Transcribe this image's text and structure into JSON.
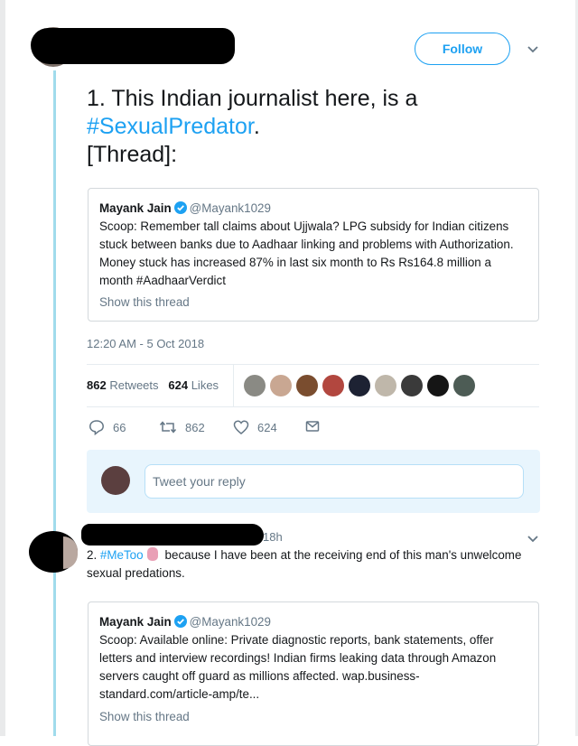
{
  "main_tweet": {
    "follow_label": "Follow",
    "text_line1": "1. This Indian journalist here, is a",
    "hashtag": "#SexualPredator",
    "hashtag_suffix": ".",
    "text_line3": "[Thread]:",
    "quoted": {
      "name": "Mayank Jain",
      "handle": "@Mayank1029",
      "text": "Scoop: Remember tall claims about Ujjwala? LPG subsidy for Indian citizens stuck between banks due to Aadhaar linking and problems with Authorization. Money stuck has increased 87% in last six month to Rs Rs164.8 million a month #AadhaarVerdict",
      "show_thread": "Show this thread"
    },
    "timestamp": "12:20 AM - 5 Oct 2018",
    "retweets_count": "862",
    "retweets_label": "Retweets",
    "likes_count": "624",
    "likes_label": "Likes",
    "liker_colors": [
      "#8a8a84",
      "#c9a792",
      "#7a4d2f",
      "#b2473f",
      "#1d2233",
      "#bfb7aa",
      "#3a3a3a",
      "#151515",
      "#4d5c55"
    ],
    "actions": {
      "replies": "66",
      "retweets": "862",
      "likes": "624"
    },
    "reply_placeholder": "Tweet your reply"
  },
  "second_tweet": {
    "time": "18h",
    "hashtag": "#MeToo",
    "text": "because I have been at the receiving end of this man's unwelcome sexual predations.",
    "number_prefix": "2.",
    "quoted": {
      "name": "Mayank Jain",
      "handle": "@Mayank1029",
      "text": "Scoop: Available online: Private diagnostic reports, bank statements, offer letters and interview recordings! Indian firms leaking data through Amazon servers caught off guard as millions affected.  wap.business-standard.com/article-amp/te...",
      "show_thread": "Show this thread"
    }
  },
  "colors": {
    "accent": "#1da1f2",
    "thread_line": "#a0dbec",
    "muted": "#657786"
  }
}
